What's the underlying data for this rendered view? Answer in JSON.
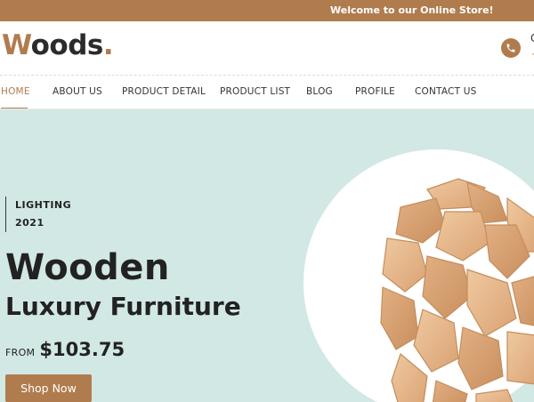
{
  "topbar": {
    "message": "Welcome to our Online Store!"
  },
  "header": {
    "logo_first": "W",
    "logo_rest": "oods",
    "logo_dot": ".",
    "phone_icon": "phone-icon",
    "fragment_1": "C",
    "fragment_2": "+"
  },
  "nav": {
    "items": [
      {
        "label": "HOME"
      },
      {
        "label": "ABOUT US"
      },
      {
        "label": "PRODUCT DETAIL"
      },
      {
        "label": "PRODUCT LIST"
      },
      {
        "label": "BLOG"
      },
      {
        "label": "PROFILE"
      },
      {
        "label": "CONTACT US"
      }
    ],
    "active": "HOME"
  },
  "hero": {
    "category": "LIGHTING",
    "year": "2021",
    "title": "Wooden",
    "subtitle": "Luxury Furniture",
    "price_prefix": "FROM",
    "price": "$103.75",
    "button_label": "Shop Now"
  },
  "colors": {
    "accent": "#b07c4e",
    "hero_bg": "#d2e8e5",
    "text": "#222222"
  }
}
